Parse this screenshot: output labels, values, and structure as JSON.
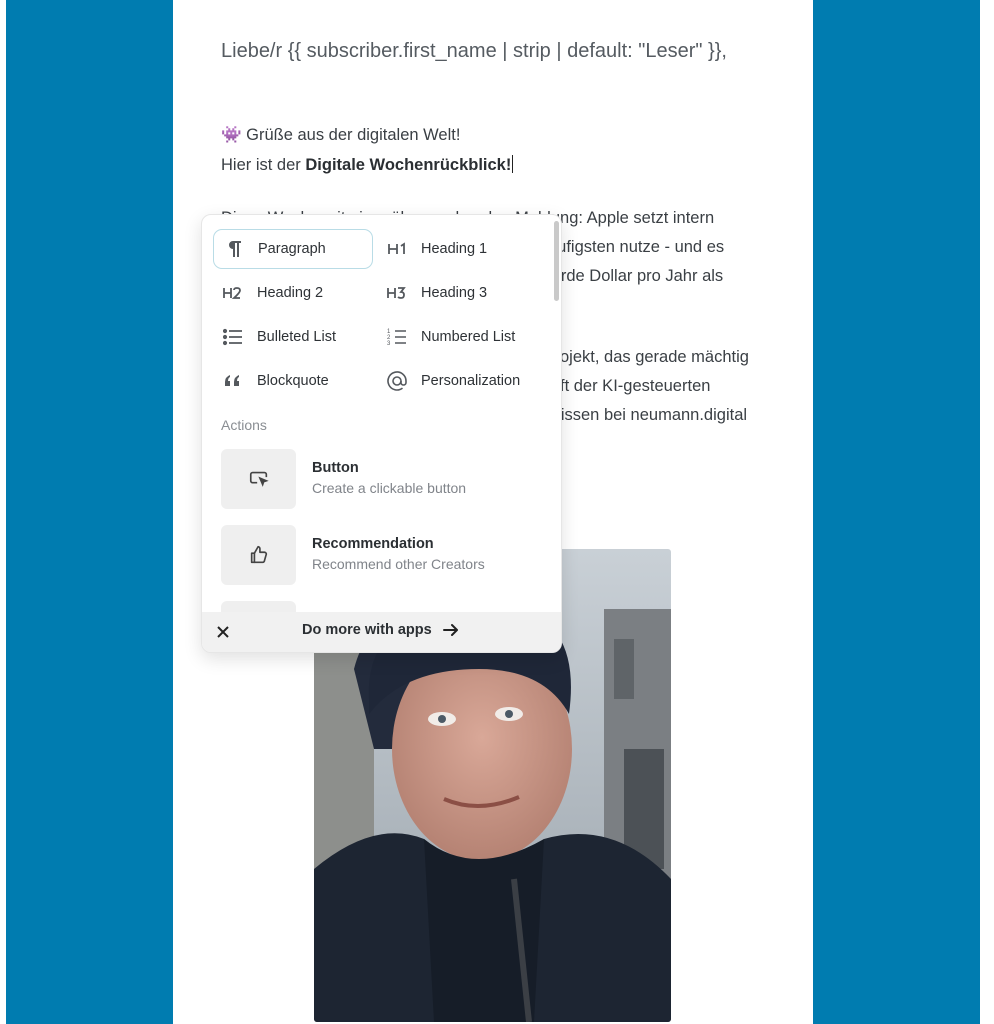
{
  "email": {
    "greeting": "Liebe/r {{ subscriber.first_name | strip | default: \"Leser\" }},",
    "emoji_line": "👾 Grüße aus der digitalen Welt!",
    "intro_prefix": "Hier ist der ",
    "intro_bold": "Digitale Wochenrückblick!",
    "para1": [
      "Diese Woche mit einer überraschenden Meldung: Apple setzt intern",
      "äufigsten nutze - und es",
      "iarde Dollar pro Jahr als"
    ],
    "para2": [
      "ojekt, das gerade mächtig",
      "ft der KI-gesteuerten",
      "ulissen bei neumann.digital"
    ]
  },
  "menu": {
    "blocks": [
      {
        "icon": "paragraph-icon",
        "label": "Paragraph"
      },
      {
        "icon": "heading-1-icon",
        "label": "Heading 1"
      },
      {
        "icon": "heading-2-icon",
        "label": "Heading 2"
      },
      {
        "icon": "heading-3-icon",
        "label": "Heading 3"
      },
      {
        "icon": "bulleted-list-icon",
        "label": "Bulleted List"
      },
      {
        "icon": "numbered-list-icon",
        "label": "Numbered List"
      },
      {
        "icon": "blockquote-icon",
        "label": "Blockquote"
      },
      {
        "icon": "at-sign-icon",
        "label": "Personalization"
      }
    ],
    "actions_label": "Actions",
    "actions": [
      {
        "icon": "cursor-click-icon",
        "title": "Button",
        "subtitle": "Create a clickable button"
      },
      {
        "icon": "thumbs-up-icon",
        "title": "Recommendation",
        "subtitle": "Recommend other Creators"
      }
    ],
    "footer_label": "Do more with apps"
  },
  "colors": {
    "background": "#007cb0",
    "card": "#ffffff",
    "active_border": "#b9dce6"
  }
}
